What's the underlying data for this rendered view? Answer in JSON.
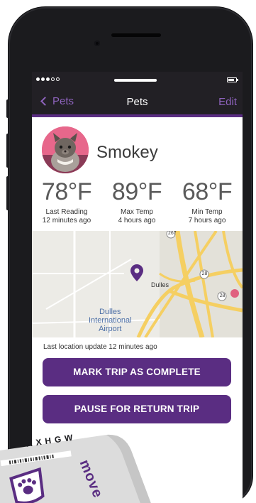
{
  "nav": {
    "back_label": "Pets",
    "title": "Pets",
    "edit_label": "Edit"
  },
  "pet": {
    "name": "Smokey"
  },
  "stats": [
    {
      "value": "78°F",
      "label": "Last Reading",
      "time": "12 minutes ago"
    },
    {
      "value": "89°F",
      "label": "Max Temp",
      "time": "4 hours ago"
    },
    {
      "value": "68°F",
      "label": "Min Temp",
      "time": "7 hours ago"
    }
  ],
  "map": {
    "place_label": "Dulles",
    "airport_label_line1": "Dulles",
    "airport_label_line2": "International",
    "airport_label_line3": "Airport",
    "road_label_1": "28",
    "road_label_2": "28",
    "road_label_3": "267"
  },
  "location_update": "Last location update 12 minutes ago",
  "buttons": {
    "complete_label": "MARK TRIP AS COMPLETE",
    "pause_label": "PAUSE FOR RETURN TRIP"
  },
  "device": {
    "code": "AXHGW",
    "brand": "move"
  },
  "colors": {
    "accent": "#5a2d82",
    "nav_link": "#8e63bd",
    "nav_bg": "#222025",
    "map_road": "#f5cf62"
  }
}
